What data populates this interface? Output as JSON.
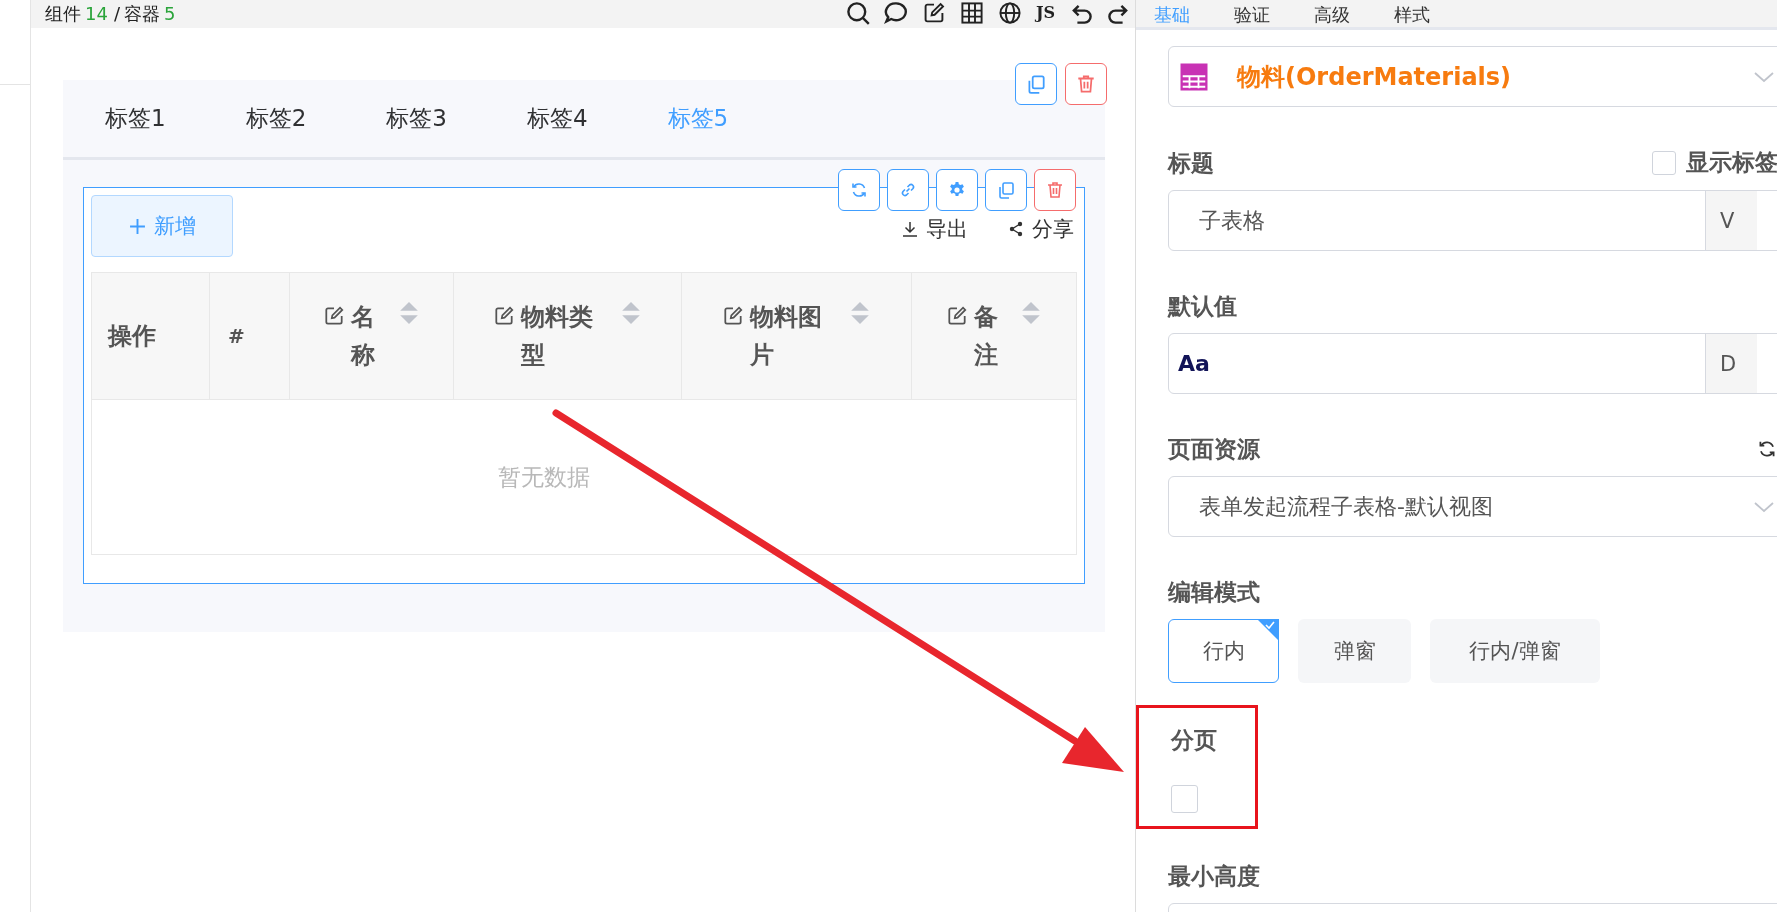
{
  "top_bar": {
    "counts": [
      {
        "label": "组件",
        "value": "14"
      },
      {
        "label": "容器",
        "value": "5"
      }
    ],
    "separator": "/",
    "tools": [
      {
        "kind": "search"
      },
      {
        "kind": "comment"
      },
      {
        "kind": "edit"
      },
      {
        "kind": "table"
      },
      {
        "kind": "globe"
      },
      {
        "kind": "text",
        "text": "JS"
      },
      {
        "kind": "undo"
      },
      {
        "kind": "redo"
      }
    ]
  },
  "tabs": [
    {
      "label": "标签1",
      "selected": false
    },
    {
      "label": "标签2",
      "selected": false
    },
    {
      "label": "标签3",
      "selected": false
    },
    {
      "label": "标签4",
      "selected": false
    },
    {
      "label": "标签5",
      "selected": true
    }
  ],
  "subtable": {
    "add_button": "新增",
    "export": "导出",
    "share": "分享",
    "columns": [
      {
        "label": "操作",
        "kind": "plain"
      },
      {
        "label": "#",
        "kind": "plain"
      },
      {
        "label": "名称",
        "kind": "field"
      },
      {
        "label": "物料类型",
        "kind": "field"
      },
      {
        "label": "物料图片",
        "kind": "field"
      },
      {
        "label": "备注",
        "kind": "field"
      }
    ],
    "empty_text": "暂无数据"
  },
  "panel": {
    "tabs": [
      {
        "label": "基础",
        "selected": true
      },
      {
        "label": "验证",
        "selected": false
      },
      {
        "label": "高级",
        "selected": false
      },
      {
        "label": "样式",
        "selected": false
      }
    ],
    "entity_select": {
      "value": "物料(OrderMaterials)"
    },
    "title": {
      "label": "标题",
      "show_label": {
        "label": "显示标签",
        "checked": false
      },
      "value": "子表格",
      "addon": "V"
    },
    "default_value": {
      "label": "默认值",
      "value": "Aa",
      "addon": "D"
    },
    "page_resource": {
      "label": "页面资源",
      "value": "表单发起流程子表格-默认视图"
    },
    "edit_mode": {
      "label": "编辑模式",
      "options": [
        {
          "label": "行内",
          "selected": true
        },
        {
          "label": "弹窗",
          "selected": false
        },
        {
          "label": "行内/弹窗",
          "selected": false
        }
      ]
    },
    "pagination": {
      "label": "分页",
      "checked": false,
      "highlighted": true
    },
    "min_height": {
      "label": "最小高度"
    }
  }
}
